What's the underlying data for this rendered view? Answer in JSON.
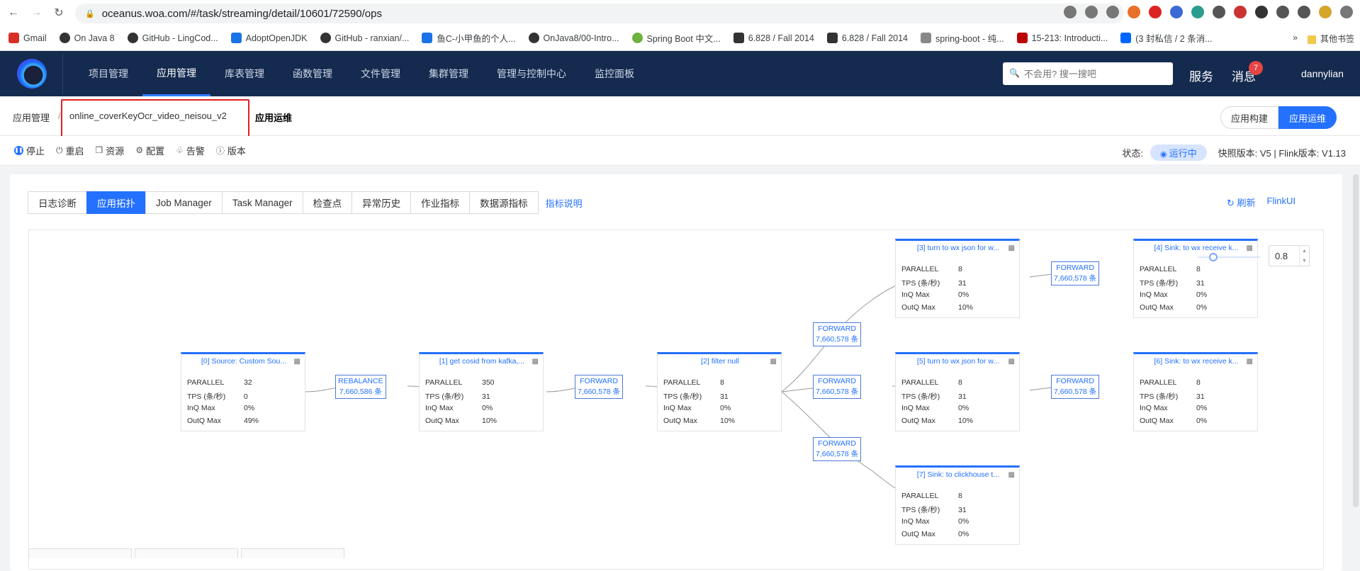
{
  "browser": {
    "url": "oceanus.woa.com/#/task/streaming/detail/10601/72590/ops",
    "bookmarks": [
      "Gmail",
      "On Java 8",
      "GitHub - LingCod...",
      "AdoptOpenJDK",
      "GitHub - ranxian/...",
      "鱼C-小甲鱼的个人...",
      "OnJava8/00-Intro...",
      "Spring Boot 中文...",
      "6.828 / Fall 2014",
      "6.828 / Fall 2014",
      "spring-boot - 纯...",
      "15-213: Introducti...",
      "(3 封私信 / 2 条消..."
    ],
    "bookmark_more": "»",
    "other_bookmarks": "其他书签"
  },
  "header": {
    "nav": [
      "项目管理",
      "应用管理",
      "库表管理",
      "函数管理",
      "文件管理",
      "集群管理",
      "管理与控制中心",
      "监控面板"
    ],
    "active_nav": 1,
    "search_placeholder": "不会用? 搜一搜吧",
    "service": "服务",
    "messages": "消息",
    "message_count": "7",
    "user": "dannylian"
  },
  "breadcrumb": {
    "root": "应用管理",
    "sep": "/",
    "app": "online_coverKeyOcr_video_neisou_v2",
    "current": "应用运维",
    "build": "应用构建",
    "ops": "应用运维"
  },
  "actions": [
    "停止",
    "重启",
    "资源",
    "配置",
    "告警",
    "版本"
  ],
  "status": {
    "label": "状态:",
    "value": "运行中",
    "version": "快照版本: V5 | Flink版本: V1.13"
  },
  "tabs": [
    "日志诊断",
    "应用拓扑",
    "Job Manager",
    "Task Manager",
    "检查点",
    "异常历史",
    "作业指标",
    "数据源指标"
  ],
  "active_tab": 1,
  "tab_help": "指标说明",
  "refresh": "刷新",
  "flink_ui": "FlinkUI",
  "zoom": "0.8",
  "node_keys": [
    "PARALLEL",
    "TPS (条/秒)",
    "InQ Max",
    "OutQ Max"
  ],
  "nodes": [
    {
      "title": "[0] Source: Custom Sou...",
      "values": [
        "32",
        "0",
        "0%",
        "49%"
      ]
    },
    {
      "title": "[1] get cosid from kafka,...",
      "values": [
        "350",
        "31",
        "0%",
        "10%"
      ]
    },
    {
      "title": "[2] filter null",
      "values": [
        "8",
        "31",
        "0%",
        "10%"
      ]
    },
    {
      "title": "[3] turn to wx json for w...",
      "values": [
        "8",
        "31",
        "0%",
        "10%"
      ]
    },
    {
      "title": "[4] Sink: to wx receive k...",
      "values": [
        "8",
        "31",
        "0%",
        "0%"
      ]
    },
    {
      "title": "[5] turn to wx json for w...",
      "values": [
        "8",
        "31",
        "0%",
        "10%"
      ]
    },
    {
      "title": "[6] Sink: to wx receive k...",
      "values": [
        "8",
        "31",
        "0%",
        "0%"
      ]
    },
    {
      "title": "[7] Sink: to clickhouse t...",
      "values": [
        "8",
        "31",
        "0%",
        "0%"
      ]
    }
  ],
  "edges": [
    {
      "type": "REBALANCE",
      "count": "7,660,586 条"
    },
    {
      "type": "FORWARD",
      "count": "7,660,578 条"
    },
    {
      "type": "FORWARD",
      "count": "7,660,578 条"
    },
    {
      "type": "FORWARD",
      "count": "7,660,578 条"
    },
    {
      "type": "FORWARD",
      "count": "7,660,578 条"
    },
    {
      "type": "FORWARD",
      "count": "7,660,578 条"
    },
    {
      "type": "FORWARD",
      "count": "7,660,578 条"
    }
  ],
  "colors": {
    "accent": "#2470ff",
    "header_bg": "#142a4f",
    "alert_red": "#e02020"
  }
}
